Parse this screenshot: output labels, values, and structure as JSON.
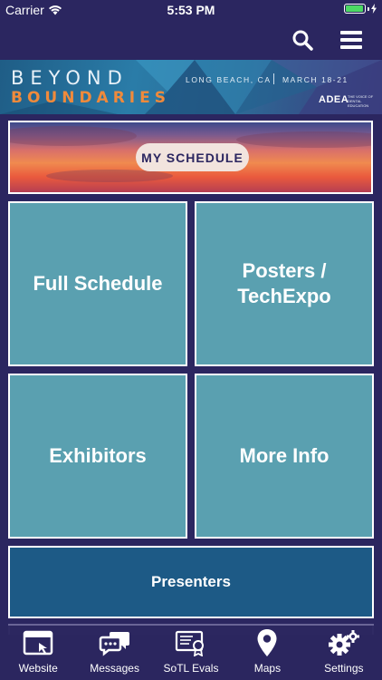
{
  "status_bar": {
    "carrier": "Carrier",
    "time": "5:53 PM",
    "battery_level": 0.95,
    "battery_color": "#4cd964"
  },
  "nav": {
    "search_icon": "search-icon",
    "menu_icon": "hamburger-menu-icon"
  },
  "banner": {
    "title_line1": "BEYOND",
    "title_line2": "BOUNDARIES",
    "location": "LONG BEACH, CA",
    "dates": "MARCH 18-21",
    "logo": "ADEA",
    "logo_tagline": "THE VOICE OF DENTAL EDUCATION"
  },
  "main": {
    "my_schedule": "MY SCHEDULE",
    "full_schedule": "Full Schedule",
    "posters_line1": "Posters /",
    "posters_line2": "TechExpo",
    "exhibitors": "Exhibitors",
    "more_info": "More Info",
    "presenters": "Presenters"
  },
  "tabs": [
    {
      "label": "Website",
      "icon": "browser-window-icon"
    },
    {
      "label": "Messages",
      "icon": "chat-bubbles-icon"
    },
    {
      "label": "SoTL Evals",
      "icon": "certificate-icon"
    },
    {
      "label": "Maps",
      "icon": "map-pin-icon"
    },
    {
      "label": "Settings",
      "icon": "gears-icon"
    }
  ],
  "colors": {
    "background": "#2b2660",
    "tile": "#5aa0b0",
    "presenters": "#1d5a86",
    "banner_accent": "#f08a3b"
  }
}
